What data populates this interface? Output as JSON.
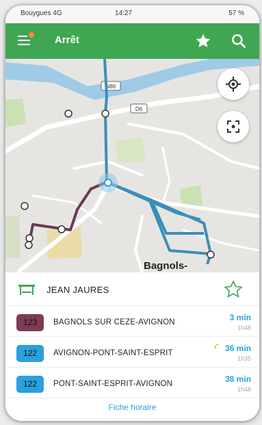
{
  "status_bar": {
    "carrier": "Bouygues 4G",
    "time": "14:27",
    "battery": "57 %"
  },
  "app_bar": {
    "title": "Arrêt"
  },
  "map": {
    "town_label": "Bagnols-",
    "road_shields": [
      "N86",
      "D6"
    ]
  },
  "stop": {
    "name": "JEAN JAURES"
  },
  "lines": [
    {
      "number": "123",
      "color": "#7d3b56",
      "destination": "BAGNOLS SUR CEZE-AVIGNON",
      "wait": "3 min",
      "scheduled": "1h48"
    },
    {
      "number": "122",
      "color": "#2aa0dc",
      "destination": "AVIGNON-PONT-SAINT-ESPRIT",
      "wait": "36 min",
      "scheduled": "1h35"
    },
    {
      "number": "122",
      "color": "#2aa0dc",
      "destination": "PONT-SAINT-ESPRIT-AVIGNON",
      "wait": "38 min",
      "scheduled": "1h48"
    }
  ],
  "footer": {
    "link": "Fiche horaire"
  },
  "colors": {
    "brand": "#3fa652",
    "route_blue": "#3a8fb8",
    "route_purple": "#6b3a56",
    "wait": "#2aa0dc"
  },
  "icons": [
    "menu-icon",
    "star-icon",
    "search-icon",
    "locate-icon",
    "focus-icon",
    "bus-stop-icon",
    "star-outline-icon",
    "realtime-icon"
  ]
}
